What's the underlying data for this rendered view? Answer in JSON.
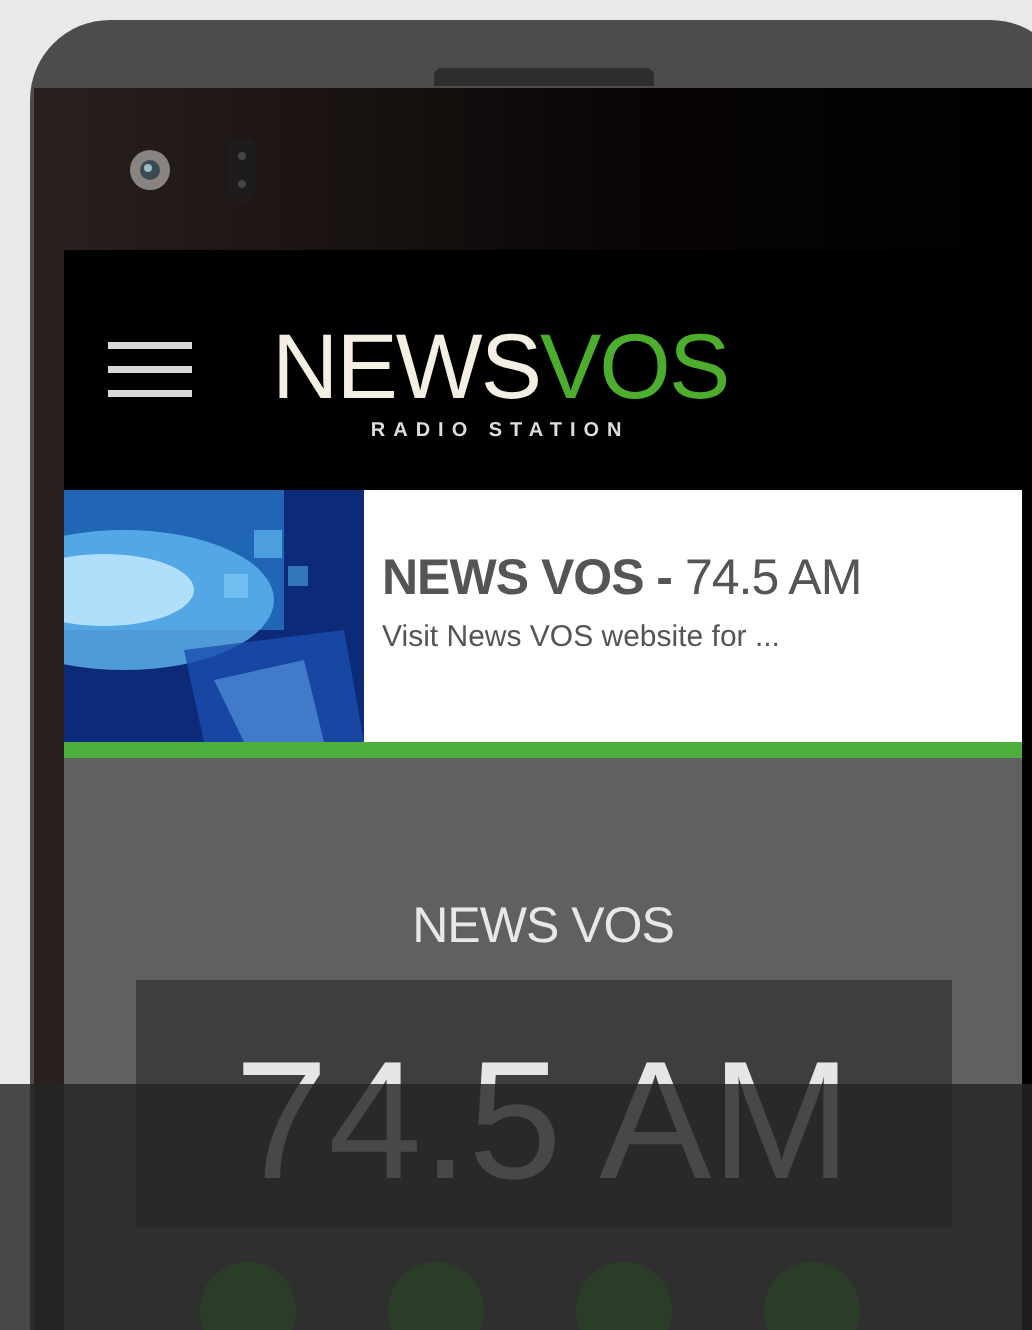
{
  "header": {
    "logo": {
      "primary": "NEWS",
      "accent": "VOS",
      "tagline": "RADIO STATION"
    }
  },
  "station_card": {
    "kind": "picture",
    "title": "**NEWS VOS -** 74.5 AM",
    "description": "Visit News VOS website for ..."
  },
  "player": {
    "station": "NEWS VOS",
    "frequency": "74.5 AM",
    "controls": [
      {
        "kind": "round-button"
      },
      {
        "kind": "round-button"
      },
      {
        "kind": "round-button"
      },
      {
        "kind": "round-button"
      }
    ]
  }
}
